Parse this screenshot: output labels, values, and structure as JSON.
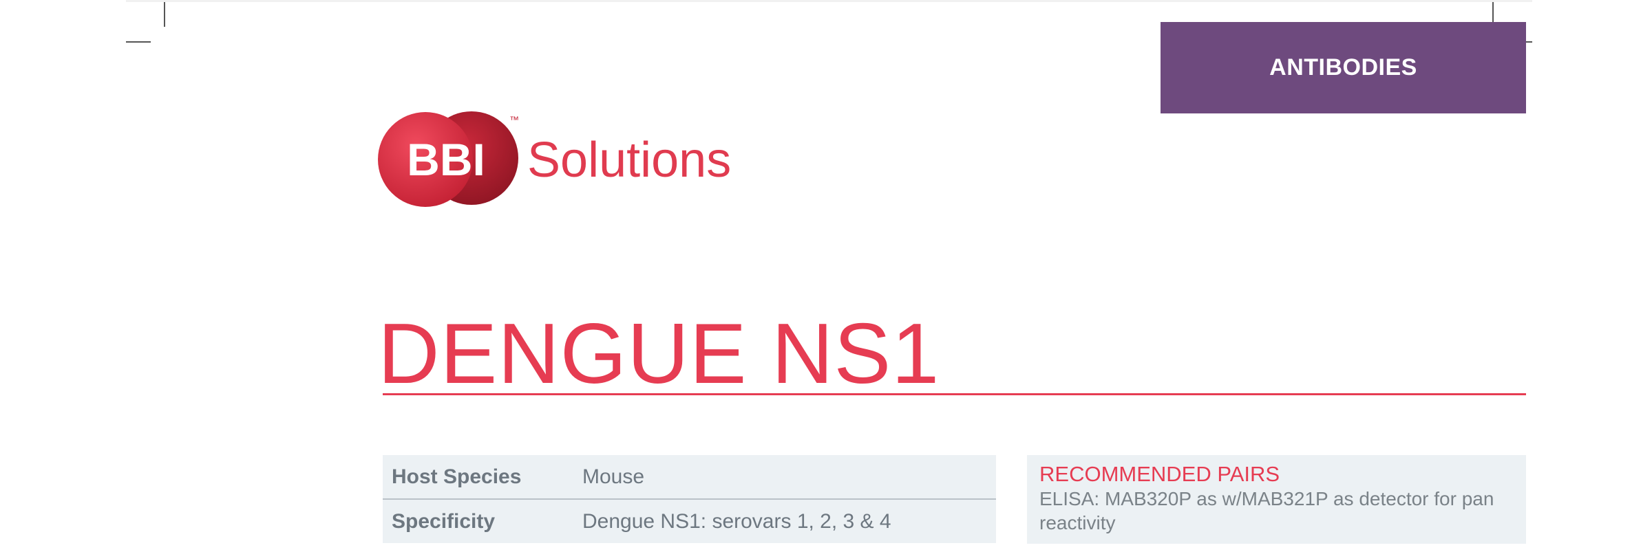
{
  "header": {
    "banner_label": "ANTIBODIES",
    "banner_color": "#6e4a7e"
  },
  "logo": {
    "mark_text": "BBI",
    "word_text": "Solutions",
    "trademark": "™",
    "brand_color": "#e03b4f",
    "dark_red": "#b01f2e"
  },
  "product": {
    "title": "DENGUE NS1",
    "title_color": "#e63c52"
  },
  "specs": [
    {
      "label": "Host Species",
      "value": "Mouse"
    },
    {
      "label": "Specificity",
      "value": "Dengue NS1: serovars 1, 2, 3 & 4"
    }
  ],
  "recommended": {
    "heading": "RECOMMENDED PAIRS",
    "text": "ELISA: MAB320P as w/MAB321P as detector for pan reactivity"
  }
}
